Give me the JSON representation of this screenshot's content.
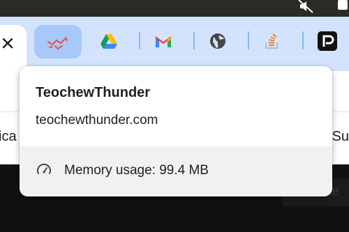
{
  "hovercard": {
    "title": "TeochewThunder",
    "domain": "teochewthunder.com",
    "memory_label": "Memory usage: 99.4 MB"
  },
  "bookmarks": {
    "left_fragment": "ica",
    "right_fragment": "Su"
  },
  "page": {
    "button_fragment": "te"
  },
  "tabs": [
    {
      "icon": "teochewthunder-favicon",
      "active": true
    },
    {
      "icon": "google-drive-icon"
    },
    {
      "icon": "gmail-icon"
    },
    {
      "icon": "globe-icon"
    },
    {
      "icon": "stack-overflow-icon"
    },
    {
      "icon": "p-app-icon"
    }
  ],
  "colors": {
    "tabstrip": "#d3e3fd",
    "active_pinned_tab": "#a8c7fa",
    "divider": "#8ab4f8",
    "card_footer": "#f1f1f1"
  }
}
